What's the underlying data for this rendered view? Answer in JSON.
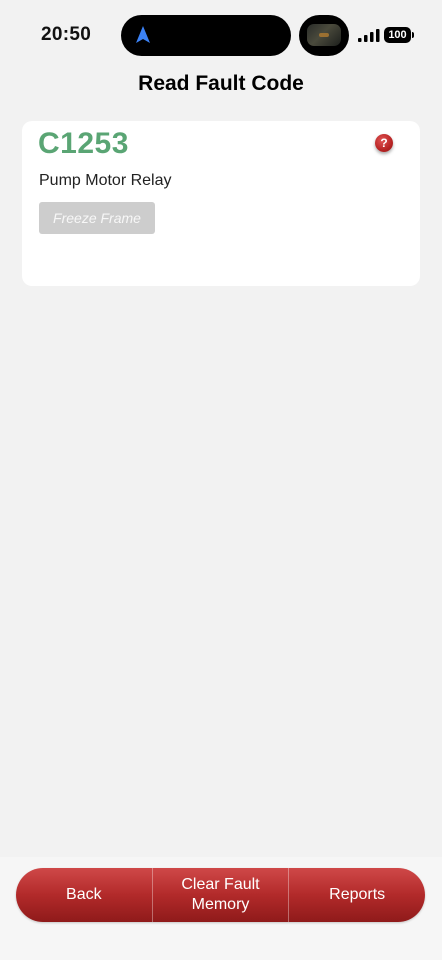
{
  "status_bar": {
    "time": "20:50",
    "battery": "100"
  },
  "header": {
    "title": "Read Fault Code"
  },
  "fault": {
    "code": "C1253",
    "description": "Pump Motor Relay",
    "freeze_frame_label": "Freeze Frame",
    "help_glyph": "?"
  },
  "toolbar": {
    "back_label": "Back",
    "clear_label": "Clear Fault\nMemory",
    "reports_label": "Reports"
  },
  "colors": {
    "background": "#f2f2f2",
    "fault_code": "#5aa574",
    "toolbar_accent": "#b22a2a",
    "nav_arrow": "#3b82f6"
  },
  "icons": {
    "navigation": "navigation-arrow-icon",
    "signal": "cellular-signal-icon",
    "battery": "battery-icon",
    "help": "help-question-icon"
  }
}
